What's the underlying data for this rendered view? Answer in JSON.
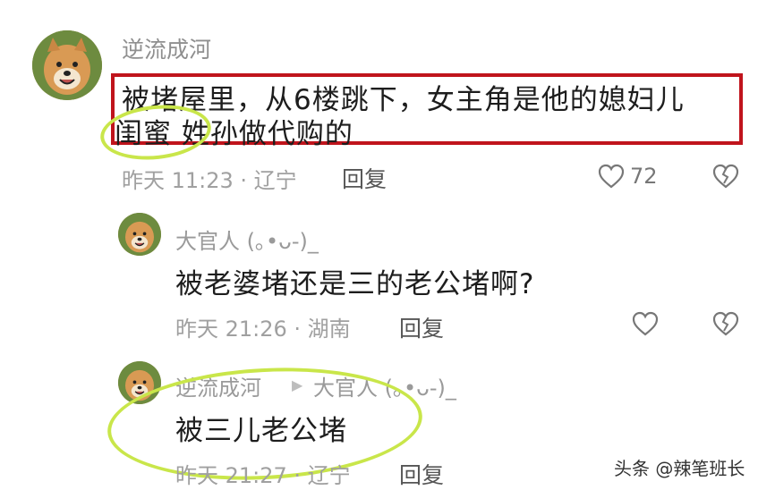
{
  "comments": [
    {
      "author": "逆流成河",
      "text_line1": "被堵屋里，从6楼跳下，女主角是他的媳妇儿",
      "text_line2": "闺蜜 姓孙做代购的",
      "meta": "昨天 11:23 · 辽宁",
      "reply_label": "回复",
      "like_count": "72"
    },
    {
      "author": "大官人 (｡•ᴗ-)_",
      "text": "被老婆堵还是三的老公堵啊?",
      "meta": "昨天 21:26 · 湖南",
      "reply_label": "回复"
    },
    {
      "author": "逆流成河",
      "reply_to": "大官人 (｡•ᴗ-)_",
      "text": "被三儿老公堵",
      "meta": "昨天 21:27 · 辽宁",
      "reply_label": "回复"
    }
  ],
  "watermark": "头条 @辣笔班长",
  "icons": {
    "like": "heart-icon",
    "dislike": "broken-heart-icon",
    "reply_arrow": "triangle-right-icon"
  },
  "colors": {
    "highlight_red": "#c0141c",
    "highlight_green": "#c9e64a"
  }
}
